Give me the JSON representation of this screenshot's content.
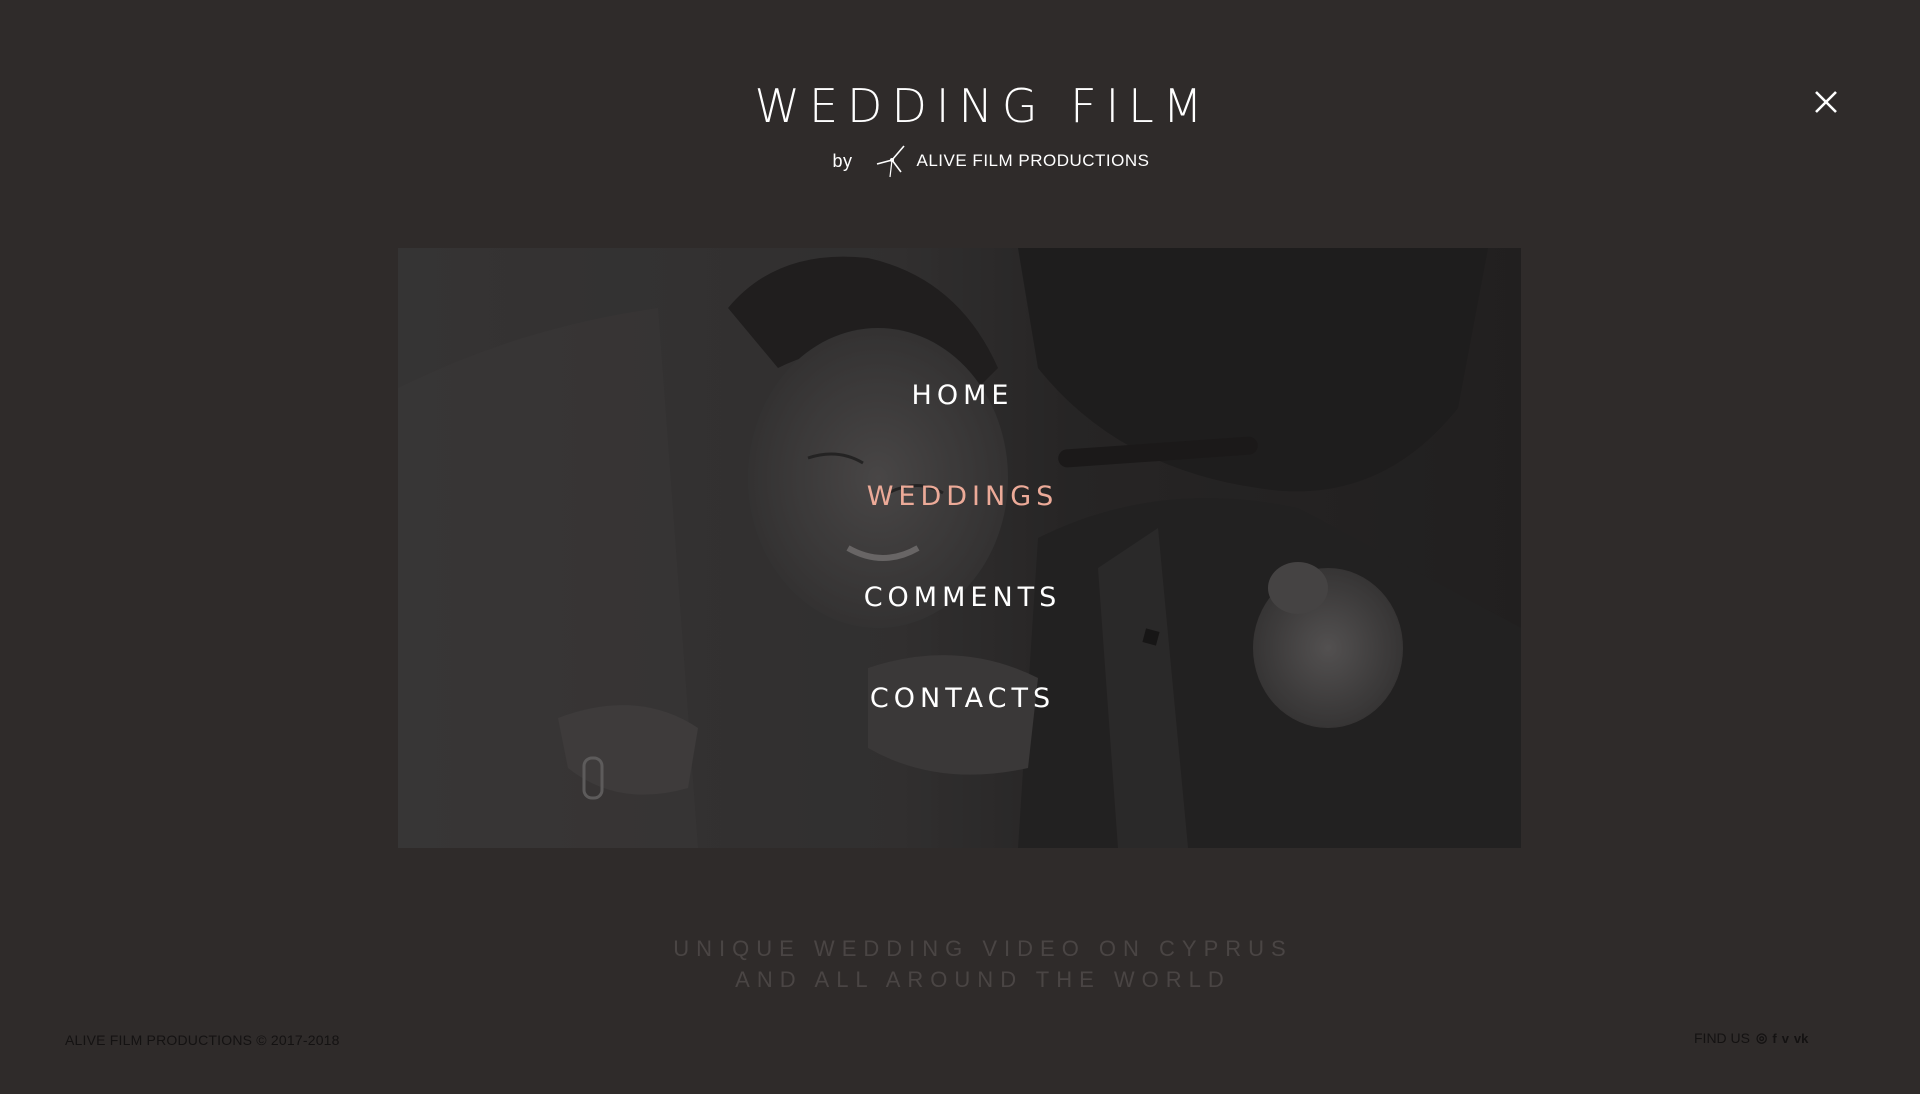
{
  "header": {
    "title": "WEDDING FILM",
    "by": "by",
    "company": "ALIVE FILM PRODUCTIONS"
  },
  "menu": {
    "items": [
      {
        "label": "HOME",
        "active": false
      },
      {
        "label": "WEDDINGS",
        "active": true
      },
      {
        "label": "COMMENTS",
        "active": false
      },
      {
        "label": "CONTACTS",
        "active": false
      }
    ],
    "active_color": "#ecaa98"
  },
  "tagline": {
    "line1": "UNIQUE WEDDING VIDEO ON CYPRUS",
    "line2": "AND ALL AROUND THE WORLD"
  },
  "footer": {
    "copyright": "ALIVE FILM PRODUCTIONS © 2017-2018",
    "find_us": "FIND US",
    "social": [
      "instagram-icon",
      "facebook-icon",
      "vimeo-icon",
      "vk-icon"
    ],
    "social_glyphs": [
      "◎",
      "f",
      "v",
      "vk"
    ]
  },
  "colors": {
    "background": "#2f2b2a",
    "text": "#ffffff"
  }
}
